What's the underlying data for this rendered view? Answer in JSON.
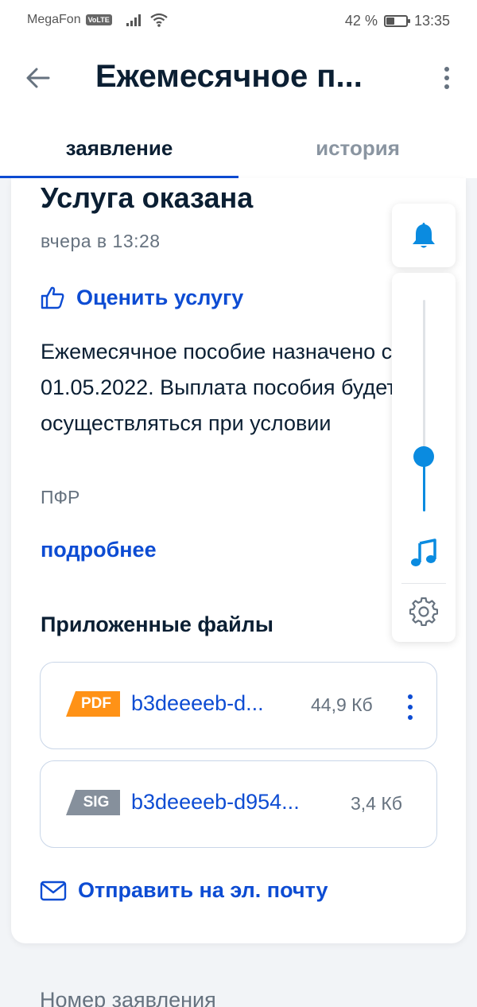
{
  "status_bar": {
    "carrier": "MegaFon",
    "volte": "VoLTE",
    "battery_percent": "42 %",
    "battery_level": 0.42,
    "time": "13:35"
  },
  "app_bar": {
    "title": "Ежемесячное п..."
  },
  "tabs": [
    {
      "label": "заявление",
      "active": true
    },
    {
      "label": "история",
      "active": false
    }
  ],
  "card": {
    "status_title": "Услуга оказана",
    "status_time": "вчера в 13:28",
    "rate_label": "Оценить услугу",
    "description": "Ежемесячное пособие назначено с 01.05.2022. Выплата пособия будет осуществляться при условии",
    "source": "ПФР",
    "more_label": "подробнее",
    "files_title": "Приложенные файлы",
    "files": [
      {
        "type": "PDF",
        "name": "b3deeeeb-d...",
        "size": "44,9 Кб"
      },
      {
        "type": "SIG",
        "name": "b3deeeeb-d954...",
        "size": "3,4 Кб"
      }
    ],
    "email_label": "Отправить на эл. почту"
  },
  "below": {
    "label": "Номер заявления"
  },
  "volume_panel": {
    "level": 0.26
  },
  "colors": {
    "accent": "#0d4cd3",
    "text": "#0b1f33",
    "muted": "#66727f",
    "pdf_badge": "#ff9216",
    "sig_badge": "#86909c",
    "volume_accent": "#0a8be0"
  }
}
